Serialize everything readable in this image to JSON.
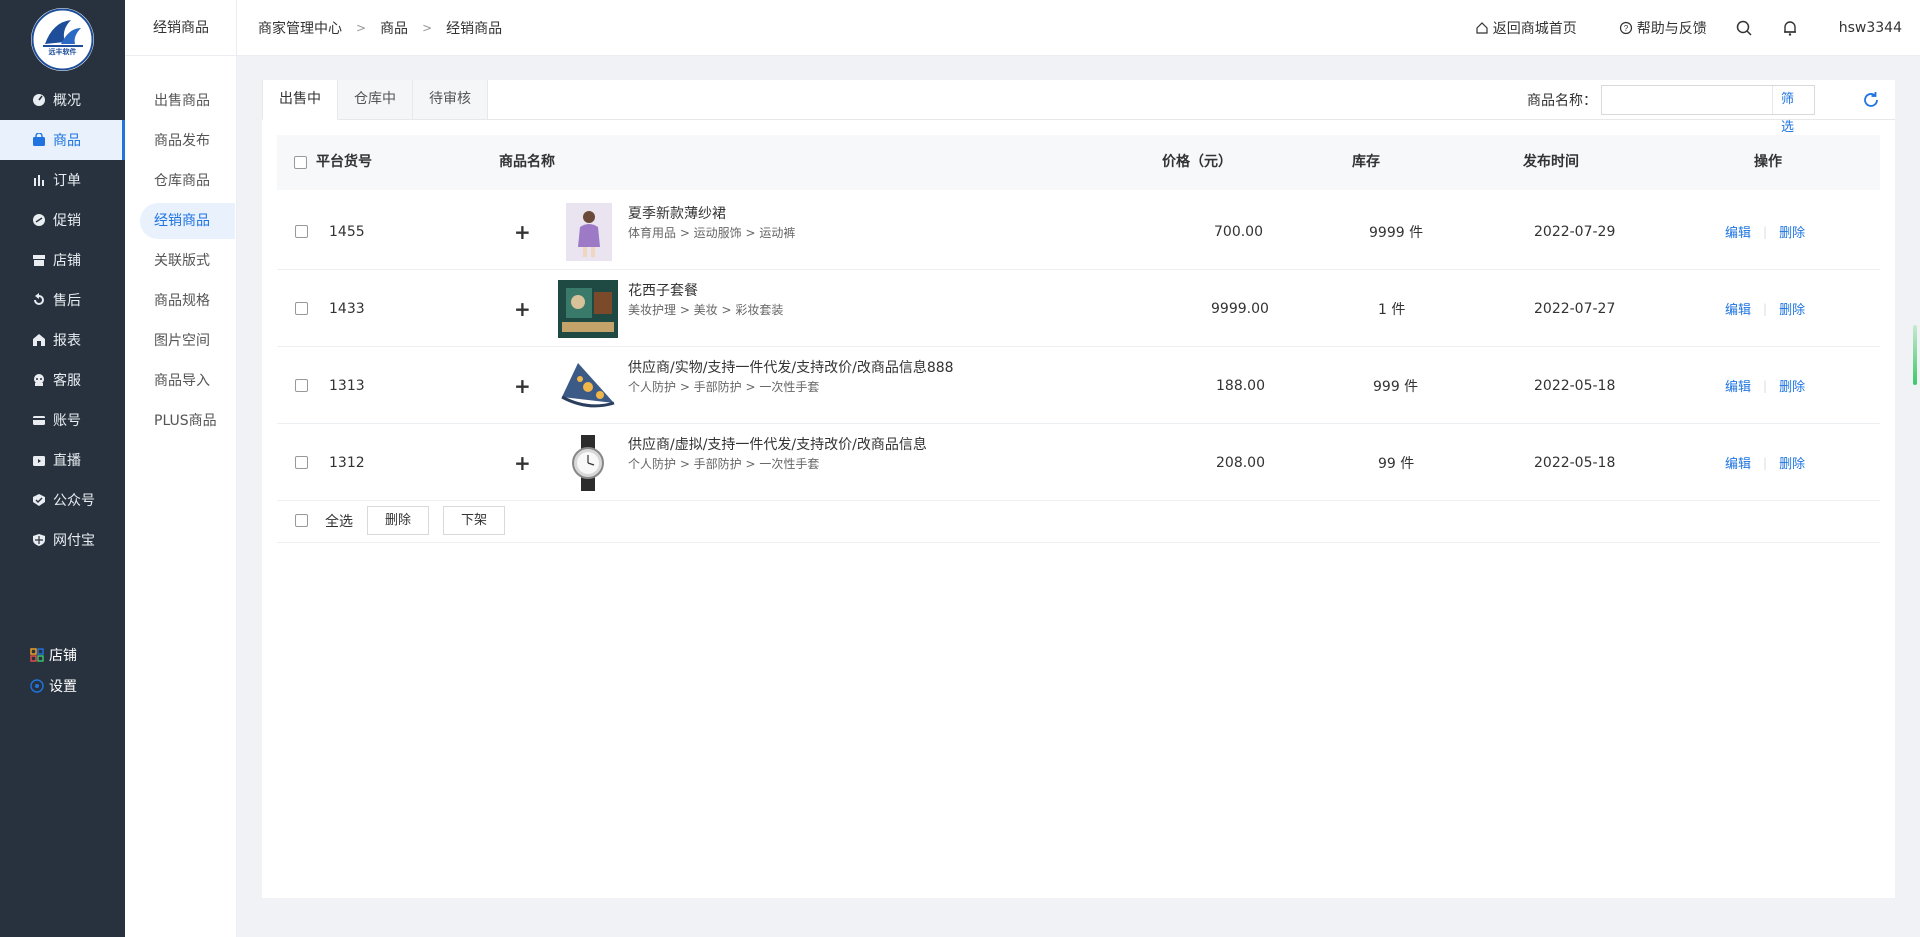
{
  "sidebar": {
    "logo_text": "远丰软件",
    "items": [
      {
        "label": "概况",
        "icon": "dashboard-icon"
      },
      {
        "label": "商品",
        "icon": "bag-icon"
      },
      {
        "label": "订单",
        "icon": "bar-chart-icon"
      },
      {
        "label": "促销",
        "icon": "promo-icon"
      },
      {
        "label": "店铺",
        "icon": "store-icon"
      },
      {
        "label": "售后",
        "icon": "aftersale-icon"
      },
      {
        "label": "报表",
        "icon": "report-icon"
      },
      {
        "label": "客服",
        "icon": "service-icon"
      },
      {
        "label": "账号",
        "icon": "card-icon"
      },
      {
        "label": "直播",
        "icon": "live-icon"
      },
      {
        "label": "公众号",
        "icon": "wechat-icon"
      },
      {
        "label": "网付宝",
        "icon": "shield-icon"
      }
    ],
    "active_index": 1,
    "bottom": [
      {
        "label": "店铺",
        "icon": "grid-icon"
      },
      {
        "label": "设置",
        "icon": "settings-icon"
      }
    ]
  },
  "subnav": {
    "title": "经销商品",
    "items": [
      "出售商品",
      "商品发布",
      "仓库商品",
      "经销商品",
      "关联版式",
      "商品规格",
      "图片空间",
      "商品导入",
      "PLUS商品"
    ],
    "active_index": 3
  },
  "header": {
    "breadcrumb": [
      "商家管理中心",
      "商品",
      "经销商品"
    ],
    "home_link": "返回商城首页",
    "help_link": "帮助与反馈",
    "username": "hsw3344"
  },
  "tabs": [
    "出售中",
    "仓库中",
    "待审核"
  ],
  "active_tab": 0,
  "filter": {
    "label": "商品名称：",
    "value": "",
    "button": "筛选"
  },
  "table": {
    "headers": {
      "id": "平台货号",
      "name": "商品名称",
      "price": "价格（元）",
      "stock": "库存",
      "date": "发布时间",
      "ops": "操作"
    },
    "rows": [
      {
        "id": "1455",
        "name": "夏季新款薄纱裙",
        "category": "体育用品 > 运动服饰 > 运动裤",
        "price": "700.00",
        "stock": "9999 件",
        "date": "2022-07-29"
      },
      {
        "id": "1433",
        "name": "花西子套餐",
        "category": "美妆护理 > 美妆 > 彩妆套装",
        "price": "9999.00",
        "stock": "1 件",
        "date": "2022-07-27"
      },
      {
        "id": "1313",
        "name": "供应商/实物/支持一件代发/支持改价/改商品信息888",
        "category": "个人防护 > 手部防护 > 一次性手套",
        "price": "188.00",
        "stock": "999 件",
        "date": "2022-05-18"
      },
      {
        "id": "1312",
        "name": "供应商/虚拟/支持一件代发/支持改价/改商品信息",
        "category": "个人防护 > 手部防护 > 一次性手套",
        "price": "208.00",
        "stock": "99 件",
        "date": "2022-05-18"
      }
    ],
    "edit_label": "编辑",
    "delete_label": "删除"
  },
  "footer": {
    "select_all": "全选",
    "delete": "删除",
    "unlist": "下架"
  },
  "colors": {
    "sidebar_bg": "#28323e",
    "accent": "#1f74e0"
  }
}
